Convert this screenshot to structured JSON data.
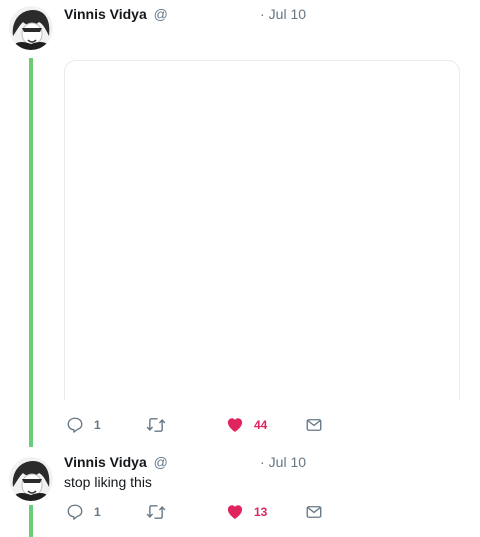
{
  "tweets": [
    {
      "name": "Vinnis Vidya",
      "handle": "@",
      "time": "Jul 10",
      "text": "",
      "replies": "1",
      "likes": "44"
    },
    {
      "name": "Vinnis Vidya",
      "handle": "@",
      "time": "Jul 10",
      "text": "stop liking this",
      "replies": "1",
      "likes": "13"
    }
  ],
  "colors": {
    "thread_line": "#6ccb73",
    "like_active": "#e0245e",
    "icon_gray": "#657786"
  },
  "icons": [
    "reply-icon",
    "retweet-icon",
    "like-icon",
    "direct-message-icon"
  ]
}
